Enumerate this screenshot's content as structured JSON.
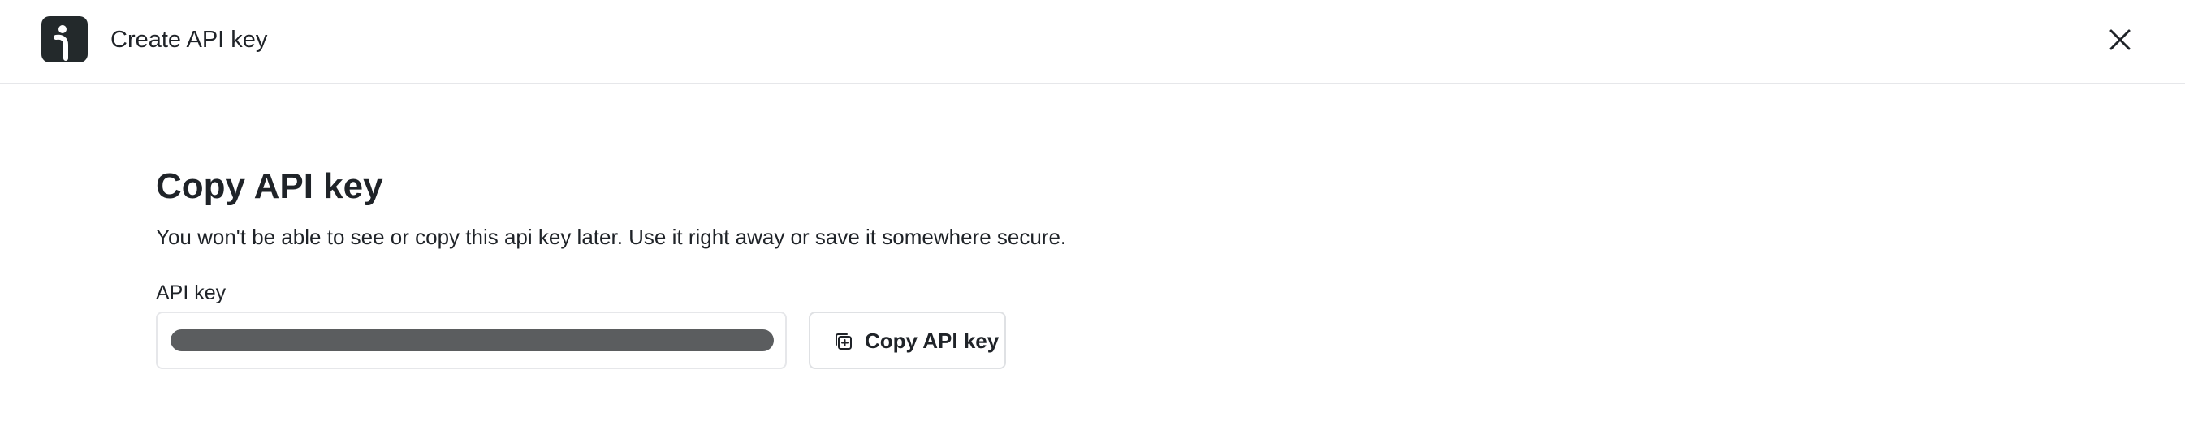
{
  "header": {
    "title": "Create API key",
    "logo_icon": "info-logo-icon",
    "close_icon": "close-icon"
  },
  "main": {
    "heading": "Copy API key",
    "description": "You won't be able to see or copy this api key later. Use it right away or save it somewhere secure.",
    "field_label": "API key",
    "copy_button_label": "Copy API key",
    "copy_icon": "copy-icon"
  },
  "colors": {
    "logo_bg": "#23292b",
    "mask": "#5b5d5f",
    "border": "#e6e7ea",
    "text": "#1f2328"
  }
}
